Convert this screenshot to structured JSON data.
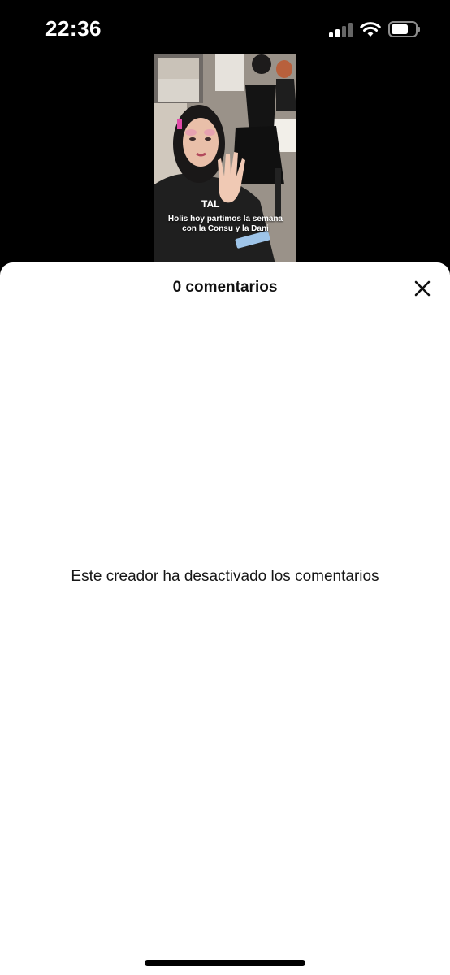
{
  "status_bar": {
    "time": "22:36",
    "icons": [
      "signal-icon",
      "wifi-icon",
      "battery-icon"
    ]
  },
  "video": {
    "caption_line1": "Holis hoy partimos la semana",
    "caption_line2": "con la Consu y la Dani"
  },
  "comments": {
    "title": "0 comentarios",
    "empty_message": "Este creador ha desactivado los comentarios",
    "close_icon": "close-icon"
  }
}
